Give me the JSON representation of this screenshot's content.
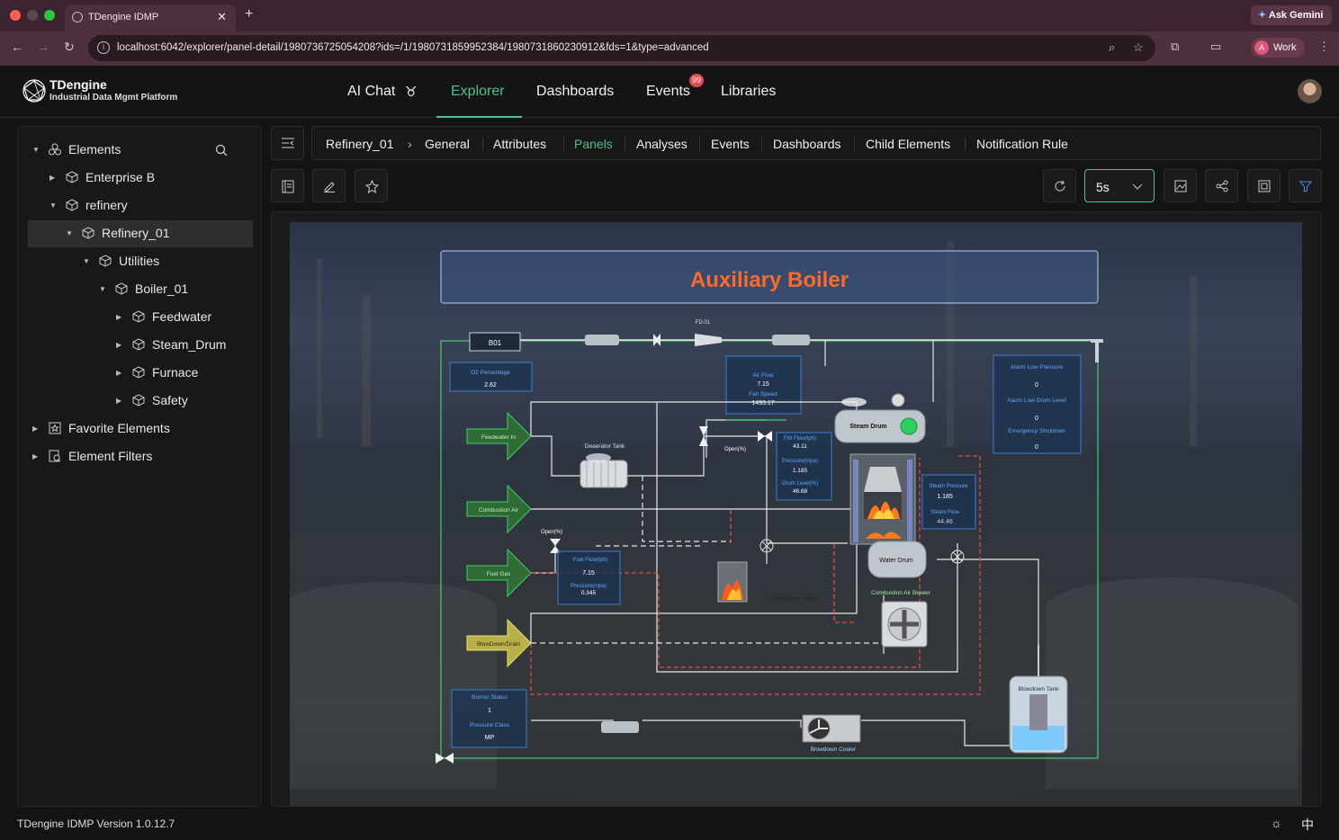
{
  "browser": {
    "tab_title": "TDengine IDMP",
    "ask_gemini": "Ask Gemini",
    "url": "localhost:6042/explorer/panel-detail/1980736725054208?ids=/1/1980731859952384/1980731860230912&fds=1&type=advanced",
    "profile_initial": "A",
    "profile_label": "Work"
  },
  "header": {
    "brand_title": "TDengine",
    "brand_subtitle": "Industrial Data Mgmt Platform",
    "nav": [
      {
        "label": "AI Chat"
      },
      {
        "label": "Explorer"
      },
      {
        "label": "Dashboards"
      },
      {
        "label": "Events"
      },
      {
        "label": "Libraries"
      }
    ],
    "active_nav": "Explorer",
    "events_badge": "99"
  },
  "sidebar": {
    "items": [
      {
        "label": "Elements"
      },
      {
        "label": "Enterprise B"
      },
      {
        "label": "refinery"
      },
      {
        "label": "Refinery_01"
      },
      {
        "label": "Utilities"
      },
      {
        "label": "Boiler_01"
      },
      {
        "label": "Feedwater"
      },
      {
        "label": "Steam_Drum"
      },
      {
        "label": "Furnace"
      },
      {
        "label": "Safety"
      },
      {
        "label": "Favorite Elements"
      },
      {
        "label": "Element Filters"
      }
    ],
    "selected": "Refinery_01"
  },
  "breadcrumb": {
    "root": "Refinery_01",
    "tabs": [
      "General",
      "Attributes",
      "Panels",
      "Analyses",
      "Events",
      "Dashboards",
      "Child Elements",
      "Notification Rule"
    ],
    "active_tab": "Panels"
  },
  "panel_toolbar": {
    "refresh_interval": "5s"
  },
  "diagram": {
    "title": "Auxiliary Boiler",
    "tag_b01": "B01",
    "tag_fd01": "FD-01",
    "o2": {
      "label": "O2 Percentage",
      "value": "2.62"
    },
    "air": {
      "label1": "Air Flow",
      "value1": "7.15",
      "label2": "Fan Speed",
      "value2": "1493.17"
    },
    "alarms": {
      "l1": "Alarm Low Pressure",
      "v1": "0",
      "l2": "Alarm Low Drum Level",
      "v2": "0",
      "l3": "Emergency Shutdown",
      "v3": "0"
    },
    "fw": {
      "l1": "FW Flow(tph)",
      "v1": "43.11",
      "l2": "Pressure(mpa)",
      "v2": "1.185",
      "l3": "Drum Level(%)",
      "v3": "46.68"
    },
    "steam": {
      "l1": "Steam Pressure",
      "v1": "1.185",
      "l2": "Steam Flow",
      "v2": "44.46"
    },
    "fuel": {
      "l1": "Fuel Flow(tph)",
      "v1": "7.15",
      "l2": "Pressure(mpa)",
      "v2": "0.345"
    },
    "burner": {
      "l1": "Burner Status",
      "v1": "1",
      "l2": "Pressure Class",
      "v2": "MP"
    },
    "inputs": [
      "Feedwater In",
      "Combustion Air",
      "Fuel Gas",
      "BlowDown/Drain"
    ],
    "labels": {
      "deaerator": "Deaerator Tank",
      "open1": "Open(%)",
      "open2": "Open(%)",
      "steam_drum": "Steam Drum",
      "water_drum": "Water Drum",
      "comb_heater": "Combustion Heater",
      "comb_blower": "Combustion Air Blower",
      "blowdown_tank": "Blowdown Tank",
      "blowdown_cooler": "Blowdown Cooler"
    }
  },
  "footer": {
    "version": "TDengine IDMP Version 1.0.12.7",
    "lang": "中"
  },
  "colors": {
    "accent": "#4cc38a",
    "title_orange": "#ff6a2a",
    "badge_red": "#e5484d"
  }
}
